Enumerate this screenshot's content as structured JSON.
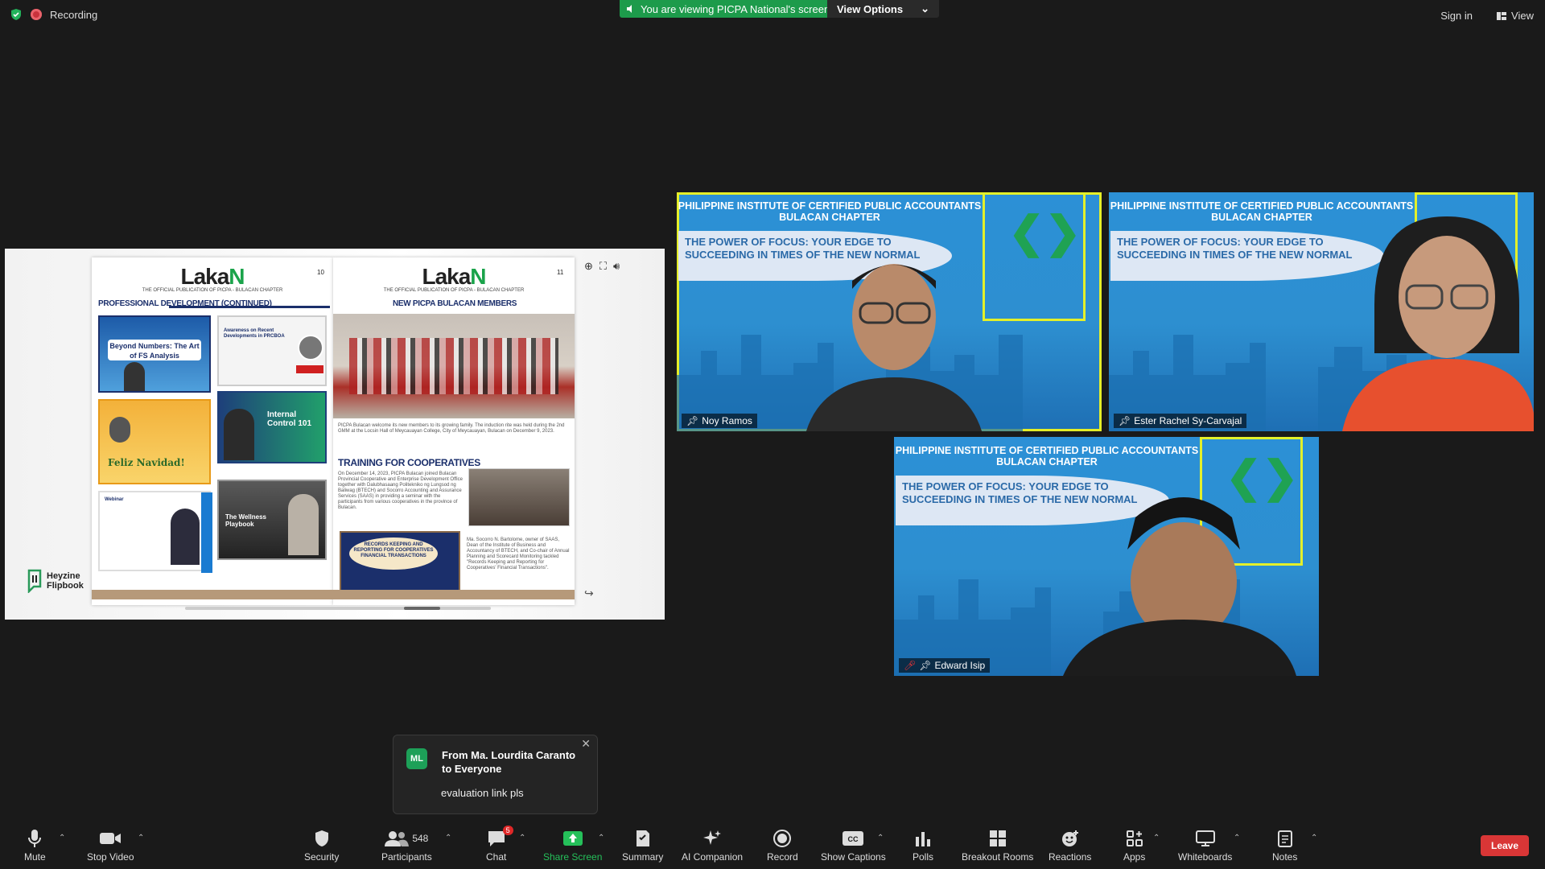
{
  "topbar": {
    "recording_label": "Recording",
    "viewing_label": "You are viewing PICPA National's screen",
    "view_options_label": "View Options",
    "sign_in_label": "Sign in",
    "view_label": "View"
  },
  "shared_screen": {
    "left_page": {
      "logo_text": "Laka",
      "logo_text_n": "N",
      "tagline": "THE OFFICIAL PUBLICATION OF PICPA - BULACAN CHAPTER",
      "page_number": "10",
      "section_title": "PROFESSIONAL DEVELOPMENT (CONTINUED)",
      "thumbs": [
        "Beyond Numbers: The Art of FS Analysis",
        "Awareness on Recent Developments in PRCBOA",
        "Feliz Navidad!",
        "Internal Control 101",
        "Webinar",
        "The Wellness Playbook"
      ]
    },
    "right_page": {
      "logo_text": "Laka",
      "logo_text_n": "N",
      "tagline": "THE OFFICIAL PUBLICATION OF PICPA - BULACAN CHAPTER",
      "page_number": "11",
      "section_title": "NEW PICPA BULACAN MEMBERS",
      "section_title_2": "TRAINING FOR COOPERATIVES",
      "paragraph_1": "PICPA Bulacan welcome its new members to its growing family. The induction rite was held during the 2nd GMM at the Locsin Hall of Meycauayan College, City of Meycauayan, Bulacan on December 9, 2023.",
      "paragraph_2": "On December 14, 2023, PICPA Bulacan joined Bulacan Provincial Cooperative and Enterprise Development Office together with Dalubhasaang Politekniko ng Lungsod ng Baliwag (BTECH) and Socorro Accounting and Assurance Services (SAAS) in providing a seminar with the participants from various cooperatives in the province of Bulacan.",
      "paragraph_3": "Ma. Socorro N. Bartolome, owner of SAAS, Dean of the Institute of Business and Accountancy of BTECH, and Co-chair of Annual Planning and Scorecard Monitoring tackled \"Records Keeping and Reporting for Cooperatives' Financial Transactions\".",
      "poster_title": "RECORDS KEEPING AND REPORTING FOR COOPERATIVES FINANCIAL TRANSACTIONS"
    },
    "branding": "Heyzine Flipbook"
  },
  "tiles": [
    {
      "org": "PHILIPPINE INSTITUTE OF CERTIFIED PUBLIC ACCOUNTANTS BULACAN CHAPTER",
      "headline": "THE POWER OF FOCUS: YOUR EDGE TO SUCCEEDING IN TIMES OF THE NEW NORMAL",
      "name": "Noy Ramos"
    },
    {
      "org": "PHILIPPINE INSTITUTE OF CERTIFIED PUBLIC ACCOUNTANTS BULACAN CHAPTER",
      "headline": "THE POWER OF FOCUS: YOUR EDGE TO SUCCEEDING IN TIMES OF THE NEW NORMAL",
      "name": "Ester Rachel Sy-Carvajal"
    },
    {
      "org": "PHILIPPINE INSTITUTE OF CERTIFIED PUBLIC ACCOUNTANTS BULACAN CHAPTER",
      "headline": "THE POWER OF FOCUS: YOUR EDGE TO SUCCEEDING IN TIMES OF THE NEW NORMAL",
      "name": "Edward Isip"
    }
  ],
  "chat_popup": {
    "avatar_initials": "ML",
    "from": "From Ma. Lourdita Caranto to Everyone",
    "message": "evaluation link pls"
  },
  "toolbar": {
    "mute": "Mute",
    "stop_video": "Stop Video",
    "security": "Security",
    "participants": "Participants",
    "participants_count": "548",
    "chat": "Chat",
    "chat_badge": "5",
    "share_screen": "Share Screen",
    "summary": "Summary",
    "ai_companion": "AI Companion",
    "record": "Record",
    "show_captions": "Show Captions",
    "polls": "Polls",
    "breakout_rooms": "Breakout Rooms",
    "reactions": "Reactions",
    "apps": "Apps",
    "whiteboards": "Whiteboards",
    "notes": "Notes",
    "leave": "Leave"
  }
}
